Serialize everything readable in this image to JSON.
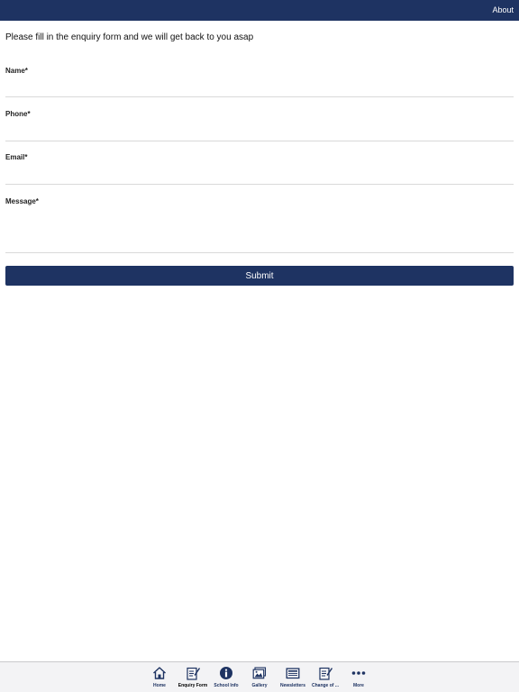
{
  "header": {
    "about_label": "About"
  },
  "form": {
    "intro": "Please fill in the enquiry form and we will get back to you asap",
    "fields": [
      {
        "label": "Name*",
        "value": ""
      },
      {
        "label": "Phone*",
        "value": ""
      },
      {
        "label": "Email*",
        "value": ""
      },
      {
        "label": "Message*",
        "value": ""
      }
    ],
    "submit_label": "Submit"
  },
  "tabbar": {
    "active": "Enquiry Form",
    "items": [
      {
        "label": "Home",
        "icon": "home-icon"
      },
      {
        "label": "Enquiry Form",
        "icon": "edit-form-icon"
      },
      {
        "label": "School Info",
        "icon": "info-icon"
      },
      {
        "label": "Gallery",
        "icon": "gallery-icon"
      },
      {
        "label": "Newsletters",
        "icon": "newsletter-icon"
      },
      {
        "label": "Change of ...",
        "icon": "edit-form-icon"
      },
      {
        "label": "More",
        "icon": "more-dots-icon"
      }
    ]
  },
  "colors": {
    "brand": "#1e3362",
    "background": "#ffffff",
    "tabbar_background": "#f3f3f5",
    "divider": "#d9d9d9"
  }
}
